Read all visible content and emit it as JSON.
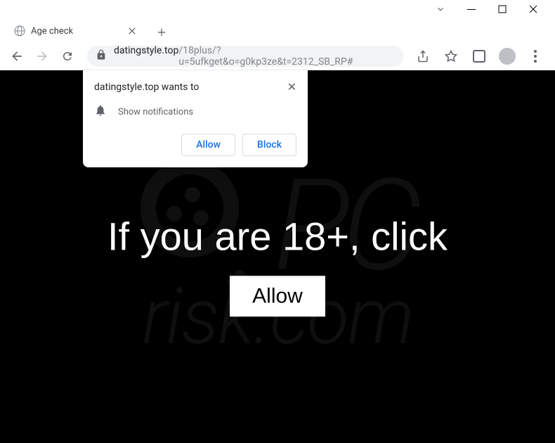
{
  "window": {
    "title": "Age check"
  },
  "tab": {
    "title": "Age check"
  },
  "address": {
    "domain": "datingstyle.top",
    "path": "/18plus/?u=5ufkget&o=g0kp3ze&t=2312_SB_RP#"
  },
  "permission": {
    "title": "datingstyle.top wants to",
    "text": "Show notifications",
    "allow": "Allow",
    "block": "Block"
  },
  "page": {
    "prompt": "If you are 18+, click",
    "button": "Allow"
  },
  "watermark": {
    "top": "PC",
    "bottom": "risk.com"
  }
}
